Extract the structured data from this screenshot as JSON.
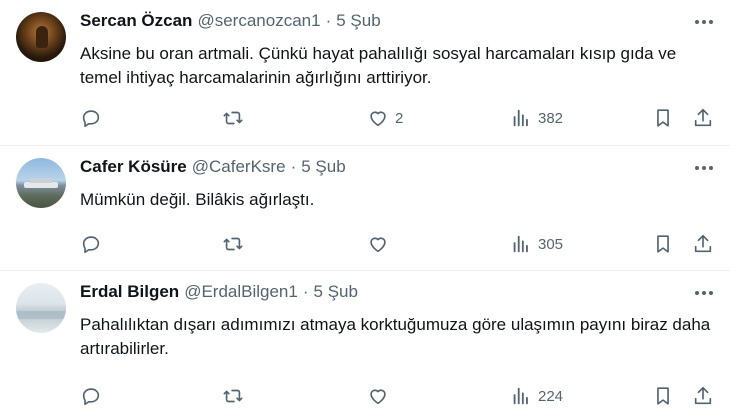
{
  "tweets": [
    {
      "name": "Sercan Özcan",
      "handle": "@sercanozcan1",
      "dot": "·",
      "date": "5 Şub",
      "text": "Aksine bu oran artmali. Çünkü hayat pahalılığı sosyal harcamaları kısıp gıda ve temel ihtiyaç harcamalarinin ağırlığını arttiriyor.",
      "likes": "2",
      "views": "382"
    },
    {
      "name": "Cafer Kösüre",
      "handle": "@CaferKsre",
      "dot": "·",
      "date": "5 Şub",
      "text": "Mümkün değil. Bilâkis ağırlaştı.",
      "likes": "",
      "views": "305"
    },
    {
      "name": "Erdal Bilgen",
      "handle": "@ErdalBilgen1",
      "dot": "·",
      "date": "5 Şub",
      "text": "Pahalılıktan dışarı adımımızı atmaya korktuğumuza göre ulaşımın payını biraz daha artırabilirler.",
      "likes": "",
      "views": "224"
    }
  ],
  "icons": {
    "reply": "reply-icon",
    "retweet": "retweet-icon",
    "like": "heart-icon",
    "views": "views-icon",
    "bookmark": "bookmark-icon",
    "share": "share-icon",
    "more": "more-icon"
  },
  "colors": {
    "text": "#0f1419",
    "secondary": "#536471",
    "divider": "#eff3f4"
  }
}
